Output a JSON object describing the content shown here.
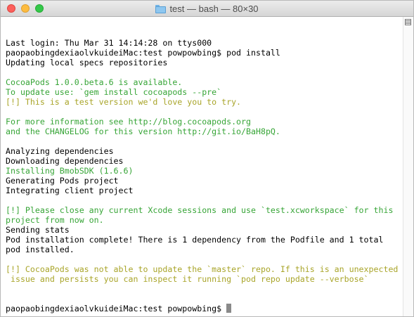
{
  "window": {
    "title": "test — bash — 80×30"
  },
  "terminal": {
    "lines": [
      {
        "text": "Last login: Thu Mar 31 14:14:28 on ttys000",
        "color": "black"
      },
      {
        "text": "paopaobingdexiaolvkuideiMac:test powpowbing$ pod install",
        "color": "black"
      },
      {
        "text": "Updating local specs repositories",
        "color": "black"
      },
      {
        "text": "",
        "color": "black"
      },
      {
        "text": "CocoaPods 1.0.0.beta.6 is available.",
        "color": "green"
      },
      {
        "text": "To update use: `gem install cocoapods --pre`",
        "color": "green"
      },
      {
        "text": "[!] This is a test version we'd love you to try.",
        "color": "yellow"
      },
      {
        "text": "",
        "color": "black"
      },
      {
        "text": "For more information see http://blog.cocoapods.org",
        "color": "green"
      },
      {
        "text": "and the CHANGELOG for this version http://git.io/BaH8pQ.",
        "color": "green"
      },
      {
        "text": "",
        "color": "black"
      },
      {
        "text": "Analyzing dependencies",
        "color": "black"
      },
      {
        "text": "Downloading dependencies",
        "color": "black"
      },
      {
        "text": "Installing BmobSDK (1.6.6)",
        "color": "green"
      },
      {
        "text": "Generating Pods project",
        "color": "black"
      },
      {
        "text": "Integrating client project",
        "color": "black"
      },
      {
        "text": "",
        "color": "black"
      },
      {
        "text": "[!] Please close any current Xcode sessions and use `test.xcworkspace` for this",
        "color": "green"
      },
      {
        "text": "project from now on.",
        "color": "green"
      },
      {
        "text": "Sending stats",
        "color": "black"
      },
      {
        "text": "Pod installation complete! There is 1 dependency from the Podfile and 1 total",
        "color": "black"
      },
      {
        "text": "pod installed.",
        "color": "black"
      },
      {
        "text": "",
        "color": "black"
      },
      {
        "text": "[!] CocoaPods was not able to update the `master` repo. If this is an unexpected",
        "color": "yellow"
      },
      {
        "text": " issue and persists you can inspect it running `pod repo update --verbose`",
        "color": "yellow"
      }
    ],
    "prompt": "paopaobingdexiaolvkuideiMac:test powpowbing$ "
  },
  "colors": {
    "black": "#000000",
    "green": "#37a537",
    "yellow": "#a9a52a",
    "close": "#fc605c",
    "minimize": "#fdbc40",
    "zoom": "#34c84a"
  },
  "icons": {
    "folder": "folder-icon",
    "split": "split-pane-icon"
  }
}
